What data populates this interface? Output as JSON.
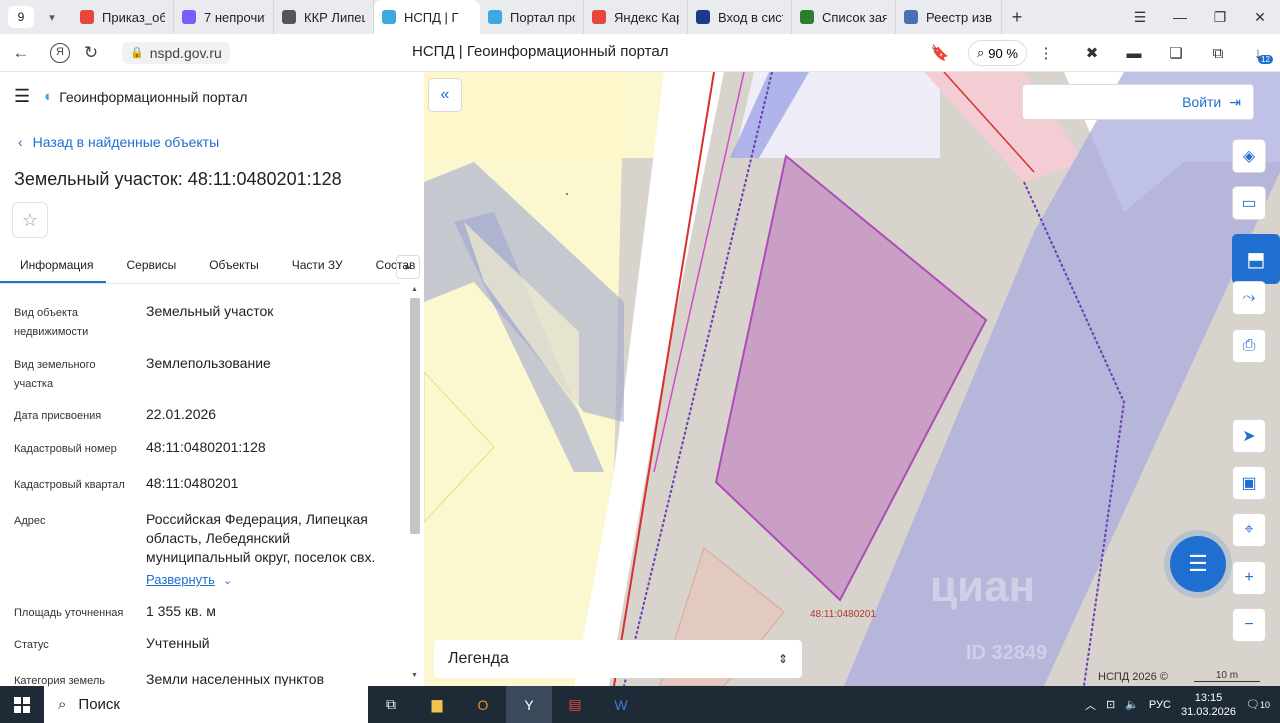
{
  "browser": {
    "tab_count": "9",
    "tabs": [
      {
        "label": "Приказ_об",
        "color": "#e8453c"
      },
      {
        "label": "7 непрочит",
        "color": "#7b5cff"
      },
      {
        "label": "ККР Липец",
        "color": "#555555"
      },
      {
        "label": "НСПД | Г",
        "color": "#3fa7e1",
        "active": true
      },
      {
        "label": "Портал про",
        "color": "#3fa7e1"
      },
      {
        "label": "Яндекс Кар",
        "color": "#e8453c"
      },
      {
        "label": "Вход в сист",
        "color": "#1a3a8a"
      },
      {
        "label": "Список зая",
        "color": "#2e7d32"
      },
      {
        "label": "Реестр изв",
        "color": "#4a6fb3"
      }
    ],
    "url": "nspd.gov.ru",
    "page_title": "НСПД | Геоинформационный портал",
    "zoom": "90 %",
    "badge": "12"
  },
  "panel": {
    "portal_name": "Геоинформационный портал",
    "back_label": "Назад в найденные объекты",
    "title": "Земельный участок: 48:11:0480201:128",
    "tabs": [
      "Информация",
      "Сервисы",
      "Объекты",
      "Части ЗУ",
      "Состав"
    ],
    "rows": [
      {
        "label": "Вид объекта недвижимости",
        "value": "Земельный участок"
      },
      {
        "label": "Вид земельного участка",
        "value": "Землепользование"
      },
      {
        "label": "Дата присвоения",
        "value": "22.01.2026"
      },
      {
        "label": "Кадастровый номер",
        "value": "48:11:0480201:128"
      },
      {
        "label": "Кадастровый квартал",
        "value": "48:11:0480201"
      },
      {
        "label": "Адрес",
        "value": "Российская Федерация, Липецкая область, Лебедянский муниципальный округ, поселок свх."
      },
      {
        "label": "Площадь уточненная",
        "value": "1 355 кв. м"
      },
      {
        "label": "Статус",
        "value": "Учтенный"
      },
      {
        "label": "Категория земель",
        "value": "Земли населенных пунктов"
      }
    ],
    "expand_label": "Развернуть"
  },
  "map": {
    "login_label": "Войти",
    "legend_label": "Легенда",
    "cadastral_label": "48:11:0480201",
    "copyright": "НСПД 2026 ©",
    "scale": "10 m",
    "watermark": "циан",
    "watermark_id": "ID 32849"
  },
  "taskbar": {
    "search_placeholder": "Поиск",
    "lang": "РУС",
    "time": "13:15",
    "date": "31.03.2026",
    "notifications": "10"
  }
}
